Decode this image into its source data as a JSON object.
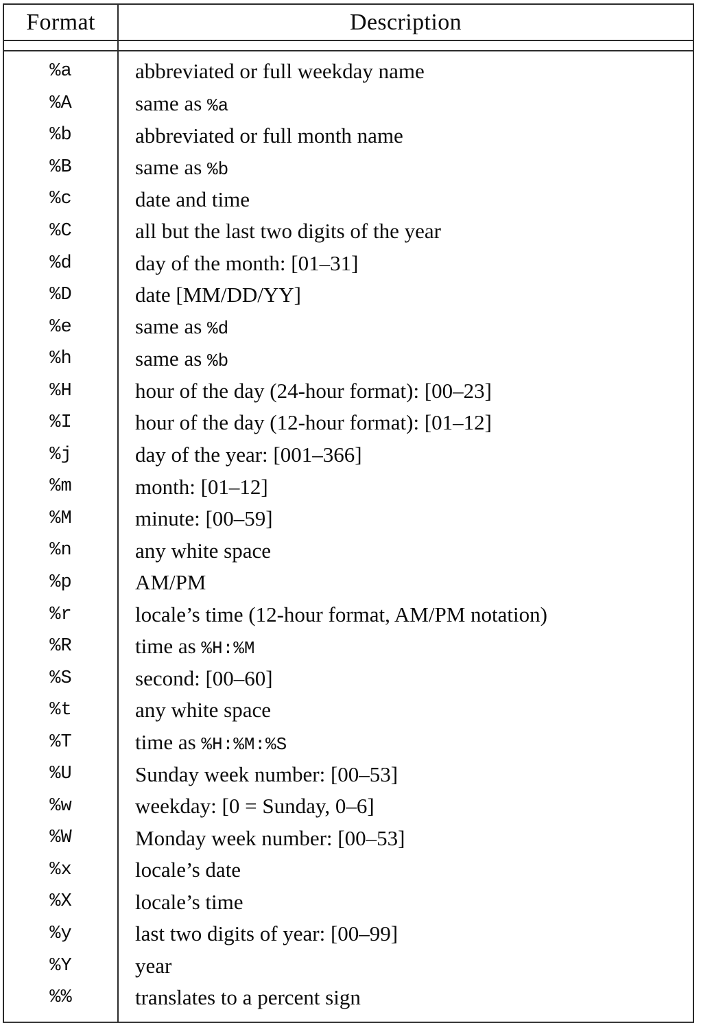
{
  "table": {
    "columns": [
      {
        "key": "format",
        "header": "Format"
      },
      {
        "key": "description",
        "header": "Description"
      }
    ],
    "rows": [
      {
        "format": "%a",
        "description": "abbreviated or full weekday name",
        "description_code": ""
      },
      {
        "format": "%A",
        "description_prefix": "same as ",
        "description_code": "%a",
        "description_suffix": ""
      },
      {
        "format": "%b",
        "description": "abbreviated or full month name"
      },
      {
        "format": "%B",
        "description_prefix": "same as ",
        "description_code": "%b",
        "description_suffix": ""
      },
      {
        "format": "%c",
        "description": "date and time"
      },
      {
        "format": "%C",
        "description": "all but the last two digits of the year"
      },
      {
        "format": "%d",
        "description": "day of the month: [01–31]"
      },
      {
        "format": "%D",
        "description": "date [MM/DD/YY]"
      },
      {
        "format": "%e",
        "description_prefix": "same as ",
        "description_code": "%d",
        "description_suffix": ""
      },
      {
        "format": "%h",
        "description_prefix": "same as ",
        "description_code": "%b",
        "description_suffix": ""
      },
      {
        "format": "%H",
        "description": "hour of the day (24-hour format): [00–23]"
      },
      {
        "format": "%I",
        "description": "hour of the day (12-hour format): [01–12]"
      },
      {
        "format": "%j",
        "description": "day of the year: [001–366]"
      },
      {
        "format": "%m",
        "description": "month: [01–12]"
      },
      {
        "format": "%M",
        "description": "minute: [00–59]"
      },
      {
        "format": "%n",
        "description": "any white space"
      },
      {
        "format": "%p",
        "description": "AM/PM"
      },
      {
        "format": "%r",
        "description": "locale’s time (12-hour format, AM/PM notation)"
      },
      {
        "format": "%R",
        "description_prefix": "time as ",
        "description_code": "%H:%M",
        "description_suffix": ""
      },
      {
        "format": "%S",
        "description": "second: [00–60]"
      },
      {
        "format": "%t",
        "description": "any white space"
      },
      {
        "format": "%T",
        "description_prefix": "time as ",
        "description_code": "%H:%M:%S",
        "description_suffix": ""
      },
      {
        "format": "%U",
        "description": "Sunday week number: [00–53]"
      },
      {
        "format": "%w",
        "description": "weekday: [0 = Sunday, 0–6]"
      },
      {
        "format": "%W",
        "description": "Monday week number: [00–53]"
      },
      {
        "format": "%x",
        "description": "locale’s date"
      },
      {
        "format": "%X",
        "description": "locale’s time"
      },
      {
        "format": "%y",
        "description": "last two digits of year: [00–99]"
      },
      {
        "format": "%Y",
        "description": "year"
      },
      {
        "format": "%%",
        "description": "translates to a percent sign"
      }
    ]
  },
  "colors": {
    "rule": "#2b2b2b",
    "text": "#0c0c0c",
    "background": "#ffffff"
  }
}
